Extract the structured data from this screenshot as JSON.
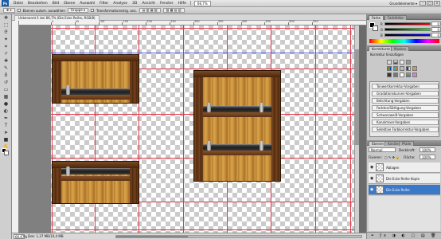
{
  "app": {
    "logo": "Ps"
  },
  "menu": [
    "Datei",
    "Bearbeiten",
    "Bild",
    "Ebene",
    "Auswahl",
    "Filter",
    "Analyse",
    "3D",
    "Ansicht",
    "Fenster",
    "Hilfe"
  ],
  "menubar": {
    "zoom": "66,7%",
    "workspace": "Grundelemente ▾"
  },
  "options": {
    "items": [
      "Ebenen autom. auswählen",
      "Gruppe ▾",
      "Transformationsstrg. anz."
    ],
    "label_before": "",
    "auto_select": "Autom. ausw.:"
  },
  "document": {
    "tab": "Unbenannt-1 bei 66,7% (Die Ecke Reihe, RGB/8)"
  },
  "ruler": {
    "marks": [
      "0",
      "50",
      "100",
      "150",
      "200",
      "250",
      "300",
      "350",
      "400",
      "450",
      "500",
      "550"
    ]
  },
  "status": {
    "zoom": "66,67%",
    "info": "Dok: 1,37 MB/10,4 MB"
  },
  "panels": {
    "color": {
      "tab": "Farbe",
      "tab2": "Farbfelder",
      "rows": [
        {
          "label": "R",
          "value": "0",
          "color": "#e03030"
        },
        {
          "label": "G",
          "value": "0",
          "color": "#30b030"
        },
        {
          "label": "B",
          "value": "0",
          "color": "#3050e0"
        }
      ]
    },
    "adjustments": {
      "tab": "Korrekturen",
      "tab2": "Masken",
      "header": "Korrektur hinzufügen",
      "presets": [
        "Tonwertkorrektur-Vorgaben",
        "Gradationskurven-Vorgaben",
        "Belichtung-Vorgaben",
        "Farbton/Sättigung-Vorgaben",
        "Schwarzweiß-Vorgaben",
        "Kanalmixer-Vorgaben",
        "Selektive Farbkorrektur-Vorgaben"
      ]
    },
    "layers": {
      "tab": "Ebenen",
      "tab2": "Kanäle",
      "tab3": "Pfade",
      "blend_mode": "Normal",
      "opacity_label": "Deckkraft:",
      "opacity": "100%",
      "lock_label": "Fixieren:",
      "fill_label": "Fläche:",
      "fill": "100%",
      "items": [
        {
          "name": "Ablagen"
        },
        {
          "name": "Die Ecke Reihe Kopie"
        },
        {
          "name": "Die Ecke Reihe"
        }
      ]
    }
  }
}
